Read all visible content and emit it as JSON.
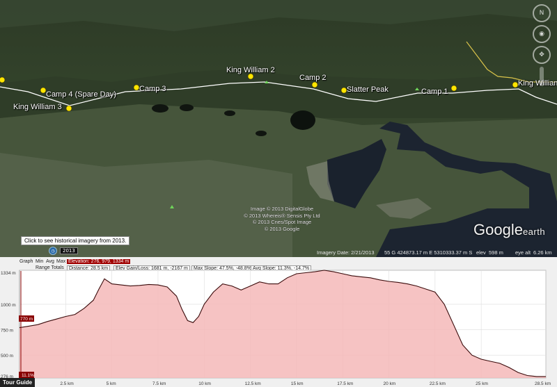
{
  "map": {
    "placemarks": [
      {
        "label": "King William 2"
      },
      {
        "label": "Camp 2"
      },
      {
        "label": "Camp 3"
      },
      {
        "label": "Camp 4 (Spare Day)"
      },
      {
        "label": "King William 3"
      },
      {
        "label": "Slatter Peak"
      },
      {
        "label": "Camp 1"
      },
      {
        "label": "King William"
      }
    ],
    "attribution": [
      "Image © 2013 DigitalGlobe",
      "© 2013 Whereis® Sensis Pty Ltd",
      "© 2013 Cnes/Spot Image",
      "© 2013 Google"
    ],
    "logo_main": "Google",
    "logo_sub": "earth",
    "historical_tip": "Click to see historical imagery from 2013.",
    "year": "2013",
    "status": {
      "imagery_date": "Imagery Date: 2/21/2013",
      "coords": "55 G 424873.17 m E 5310333.37 m S",
      "elev_label": "elev",
      "elev_value": "598 m",
      "eye_label": "eye alt",
      "eye_value": "6.26 km"
    }
  },
  "profile": {
    "graph_label": "Graph",
    "min_label": "Min",
    "avg_label": "Avg",
    "max_label": "Max",
    "elevation_tag": "Elevation: 276, 979, 1334 m",
    "range_totals_label": "Range Totals",
    "distance": "Distance: 28.5 km",
    "elev_gain_loss": "Elev Gain/Loss: 1681 m, -2167 m",
    "max_slope": "Max Slope: 47.5%, -48.8%",
    "avg_slope": "Avg Slope: 11.3%, -14.7%",
    "marker_top": "770 m",
    "marker_bottom": "11.1%",
    "tour_guide": "Tour Guide"
  },
  "chart_data": {
    "type": "area",
    "xlabel": "",
    "ylabel": "",
    "xlim": [
      0,
      28.5
    ],
    "ylim": [
      276,
      1334
    ],
    "y_ticks": [
      "1334 m",
      "1000 m",
      "750 m",
      "500 m",
      "276 m"
    ],
    "x_ticks": [
      "2.5 km",
      "5 km",
      "7.5 km",
      "10 km",
      "12.5 km",
      "15 km",
      "17.5 km",
      "20 km",
      "22.5 km",
      "25 km",
      "28.5 km"
    ],
    "x": [
      0,
      0.5,
      1,
      1.5,
      2,
      2.5,
      3,
      3.5,
      4,
      4.3,
      4.6,
      5,
      5.5,
      6,
      6.5,
      7,
      7.5,
      8,
      8.5,
      8.8,
      9.1,
      9.4,
      9.7,
      10,
      10.5,
      11,
      11.5,
      12,
      12.5,
      13,
      13.5,
      14,
      14.5,
      15,
      15.5,
      16,
      16.5,
      17,
      17.5,
      18,
      18.5,
      19,
      19.5,
      20,
      20.5,
      21,
      21.5,
      22,
      22.5,
      23,
      23.5,
      24,
      24.5,
      25,
      25.5,
      26,
      26.5,
      27,
      27.5,
      28,
      28.5
    ],
    "series": [
      {
        "values": [
          770,
          785,
          800,
          830,
          855,
          880,
          900,
          960,
          1040,
          1150,
          1250,
          1200,
          1190,
          1180,
          1185,
          1195,
          1190,
          1170,
          1080,
          950,
          840,
          820,
          880,
          1000,
          1120,
          1200,
          1180,
          1140,
          1180,
          1220,
          1200,
          1200,
          1260,
          1300,
          1310,
          1320,
          1334,
          1320,
          1300,
          1280,
          1270,
          1260,
          1240,
          1225,
          1215,
          1200,
          1180,
          1150,
          1120,
          1000,
          800,
          600,
          500,
          460,
          440,
          420,
          380,
          330,
          300,
          290,
          290
        ]
      }
    ]
  }
}
